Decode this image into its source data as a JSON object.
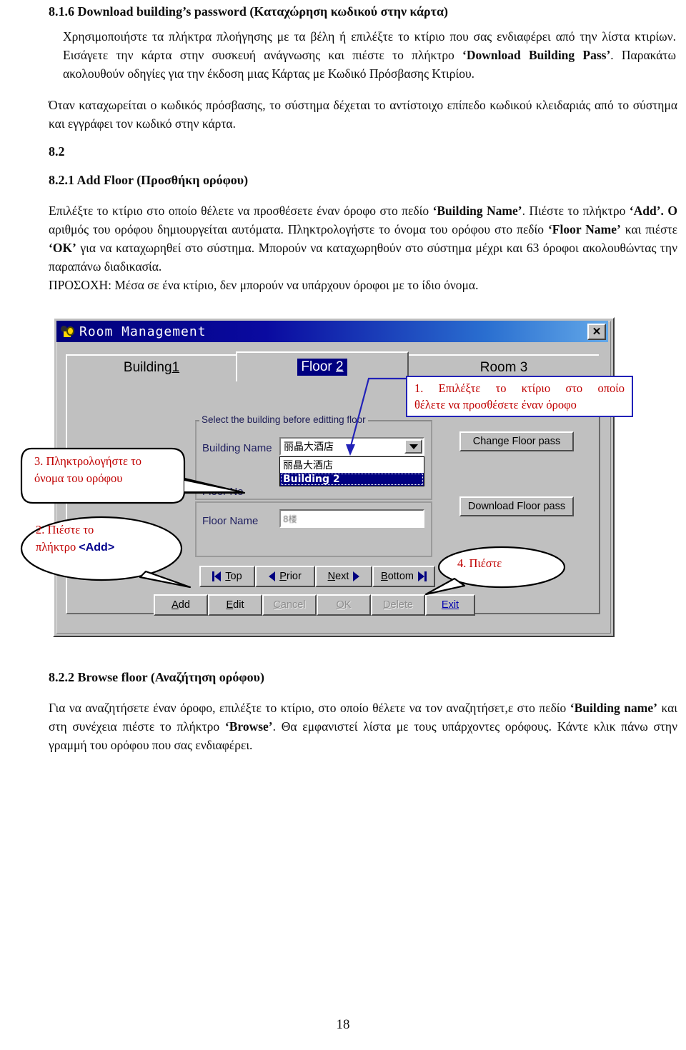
{
  "document": {
    "section_816_heading": "8.1.6 Download building’s password (Καταχώρηση κωδικού στην κάρτα)",
    "para_816": "Χρησιμοποιήστε τα πλήκτρα πλοήγησης με τα βέλη ή επιλέξτε το κτίριο που σας ενδιαφέρει από την λίστα κτιρίων. Εισάγετε την κάρτα στην συσκευή ανάγνωσης και πιέστε το πλήκτρο ",
    "para_816_bold": "‘Download Building Pass’",
    "para_816_tail": ". Παρακάτω ακολουθούν οδηγίες για την έκδοση μιας Κάρτας με Κωδικό Πρόσβασης Κτιρίου.",
    "para_2": "Όταν καταχωρείται ο κωδικός πρόσβασης, το σύστημα δέχεται το αντίστοιχο επίπεδο κωδικού κλειδαριάς από το σύστημα και εγγράφει τον κωδικό στην κάρτα.",
    "section_82_heading": "8.2",
    "section_821_heading": "8.2.1 Add Floor (Προσθήκη ορόφου)",
    "para_821_a": "Επιλέξτε το κτίριο στο οποίο θέλετε να προσθέσετε έναν όροφο στο πεδίο ",
    "para_821_b1": "‘Building Name’",
    "para_821_c": ". Πιέστε το πλήκτρο ",
    "para_821_b2": "‘Add’. Ο",
    "para_821_d": " αριθμός του ορόφου δημιουργείται αυτόματα. Πληκτρολογήστε το όνομα του ορόφου στο πεδίο ",
    "para_821_b3": "‘Floor Name’",
    "para_821_e": " και πιέστε ",
    "para_821_b4": "‘OK’",
    "para_821_f": " για να καταχωρηθεί στο σύστημα. Μπορούν να καταχωρηθούν στο σύστημα μέχρι και 63 όροφοι ακολουθώντας την παραπάνω διαδικασία.",
    "para_821_warning": "ΠΡΟΣΟΧΗ: Μέσα σε ένα κτίριο, δεν μπορούν να υπάρχουν όροφοι με το ίδιο όνομα.",
    "section_822_heading": "8.2.2  Browse floor (Αναζήτηση ορόφου)",
    "para_822_a": "Για να αναζητήσετε έναν όροφο, επιλέξτε το κτίριο, στο οποίο θέλετε να τον αναζητήσετ,ε στο πεδίο ",
    "para_822_b1": "‘Building name’",
    "para_822_b": " και στη συνέχεια πιέστε το πλήκτρο ",
    "para_822_b2": "‘Browse’",
    "para_822_c": ". Θα εμφανιστεί λίστα με τους υπάρχοντες ορόφους. Κάντε κλικ πάνω στην γραμμή του ορόφου που σας ενδιαφέρει.",
    "page_number": "18"
  },
  "screenshot": {
    "window": {
      "title": "Room  Management",
      "close_label": "✕",
      "icon": "key-icon"
    },
    "tabs": [
      {
        "prefix": "Building ",
        "accel": "1",
        "selected": false
      },
      {
        "prefix": "Floor ",
        "accel": "2",
        "selected": true
      },
      {
        "prefix": "Room 3",
        "accel": "",
        "selected": false
      }
    ],
    "group": {
      "title": "Select the building before editting floor",
      "building_name_label": "Building Name",
      "building_name_value": "丽晶大酒店",
      "dropdown_options": [
        {
          "label": "丽晶大酒店",
          "selected": false
        },
        {
          "label": "Building 2",
          "selected": true
        }
      ],
      "floor_no_label": "Floor No",
      "floor_name_label": "Floor Name",
      "floor_name_value": "8楼"
    },
    "side_buttons": [
      {
        "label": "Change Floor pass"
      },
      {
        "label": "Download Floor pass"
      }
    ],
    "nav_buttons": [
      {
        "label": "Top",
        "accel": "T",
        "icon": "first-record-icon"
      },
      {
        "label": "Prior",
        "accel": "P",
        "icon": "prev-record-icon"
      },
      {
        "label": "Next",
        "accel": "N",
        "icon": "next-record-icon"
      },
      {
        "label": "Bottom",
        "accel": "B",
        "icon": "last-record-icon"
      }
    ],
    "action_buttons": [
      {
        "label": "Add",
        "accel": "A",
        "state": "enabled"
      },
      {
        "label": "Edit",
        "accel": "E",
        "state": "enabled"
      },
      {
        "label": "Cancel",
        "accel": "C",
        "state": "disabled"
      },
      {
        "label": "OK",
        "accel": "O",
        "state": "disabled"
      },
      {
        "label": "Delete",
        "accel": "D",
        "state": "disabled"
      },
      {
        "label": "Exit",
        "accel": "x",
        "state": "link"
      }
    ]
  },
  "callouts": {
    "one_line1": "1. Επιλέξτε το κτίριο στο οποίο",
    "one_line2": "θέλετε να προσθέσετε έναν όροφο",
    "two_line1": "2. Πιέστε το",
    "two_line2_pre": "πλήκτρο ",
    "two_key": "<Add>",
    "three_line1": "3. Πληκτρολογήστε το",
    "three_line2": "όνομα του ορόφου",
    "four_line1": "4. Πιέστε"
  },
  "colors": {
    "callout_text": "#c00000",
    "callout1_border": "#2222b8",
    "window_face": "#c0c0c0",
    "titlebar_start": "#00007a",
    "selection": "#000080"
  }
}
